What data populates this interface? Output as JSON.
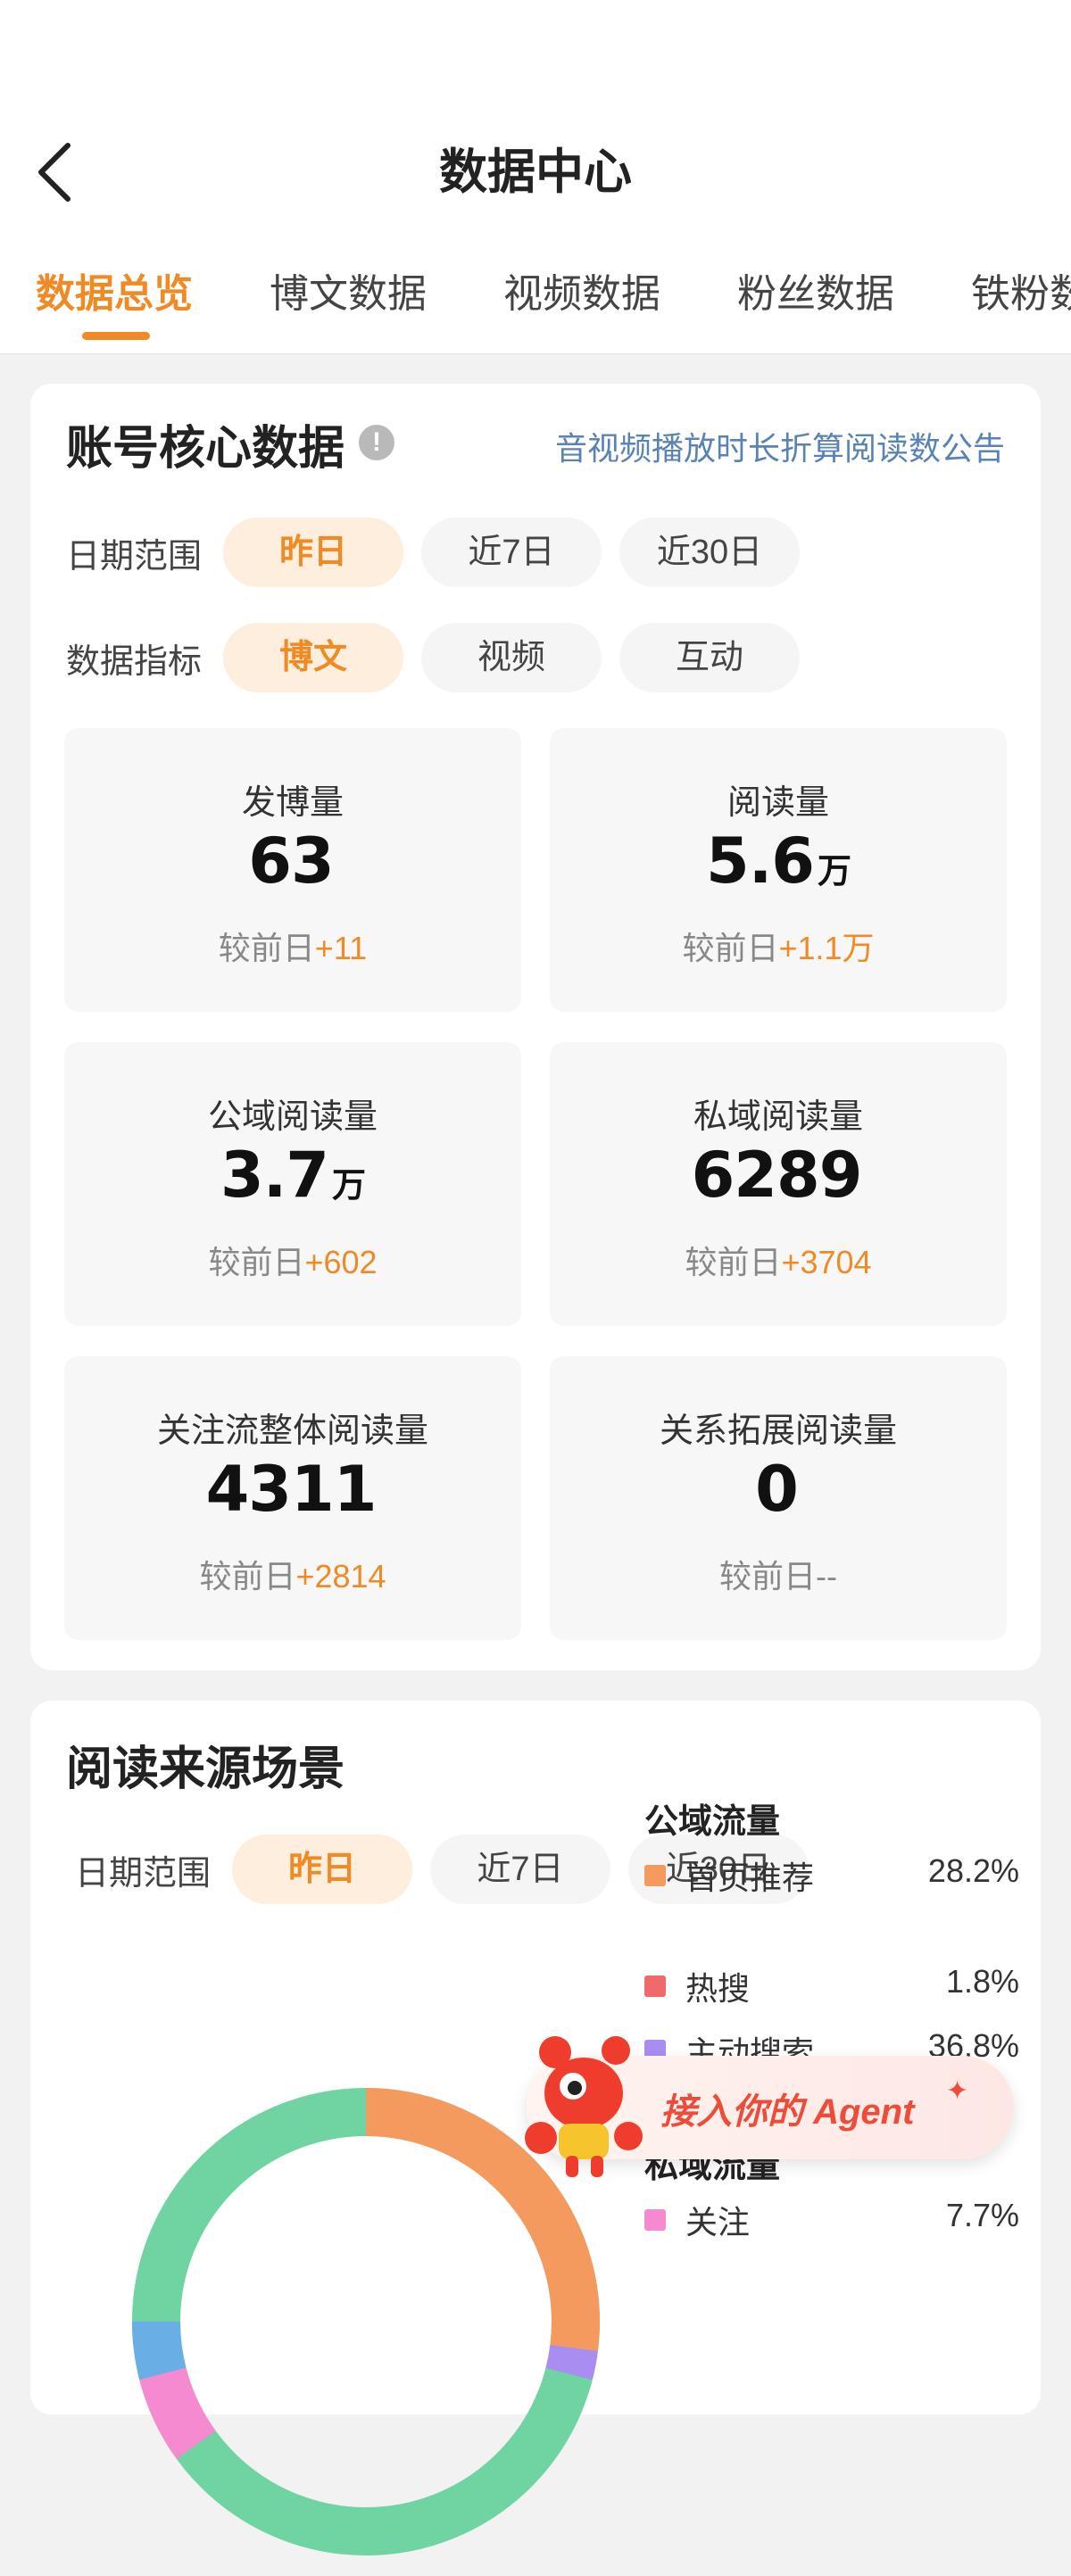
{
  "header": {
    "title": "数据中心"
  },
  "tabs": [
    {
      "label": "数据总览",
      "active": true
    },
    {
      "label": "博文数据"
    },
    {
      "label": "视频数据"
    },
    {
      "label": "粉丝数据"
    },
    {
      "label": "铁粉数"
    }
  ],
  "core": {
    "title": "账号核心数据",
    "notice_link": "音视频播放时长折算阅读数公告",
    "date_label": "日期范围",
    "date_options": [
      "昨日",
      "近7日",
      "近30日"
    ],
    "metric_label": "数据指标",
    "metric_options": [
      "博文",
      "视频",
      "互动"
    ],
    "compare_prefix": "较前日",
    "stats": [
      {
        "label": "发博量",
        "value": "63",
        "unit": "",
        "delta": "+11"
      },
      {
        "label": "阅读量",
        "value": "5.6",
        "unit": "万",
        "delta": "+1.1万"
      },
      {
        "label": "公域阅读量",
        "value": "3.7",
        "unit": "万",
        "delta": "+602"
      },
      {
        "label": "私域阅读量",
        "value": "6289",
        "unit": "",
        "delta": "+3704"
      },
      {
        "label": "关注流整体阅读量",
        "value": "4311",
        "unit": "",
        "delta": "+2814"
      },
      {
        "label": "关系拓展阅读量",
        "value": "0",
        "unit": "",
        "delta": "--"
      }
    ]
  },
  "source": {
    "title": "阅读来源场景",
    "date_label": "日期范围",
    "date_options": [
      "昨日",
      "近7日",
      "近30日"
    ],
    "public_title": "公域流量",
    "public_items": [
      {
        "label": "首页推荐",
        "pct": "28.2%",
        "color": "#f59a5e"
      },
      {
        "label": "热搜",
        "pct": "1.8%",
        "color": "#f06a6a"
      },
      {
        "label": "主动搜索",
        "pct": "36.8%",
        "color": "#a98df0"
      }
    ],
    "private_title": "私域流量",
    "private_items": [
      {
        "label": "关注",
        "pct": "7.7%",
        "color": "#f58ad0"
      }
    ],
    "ring_colors": [
      "#f59a5e",
      "#a98df0",
      "#f58ad0",
      "#6aaee6",
      "#6fd3a2"
    ]
  },
  "agent_banner": {
    "text": "接入你的 Agent"
  }
}
